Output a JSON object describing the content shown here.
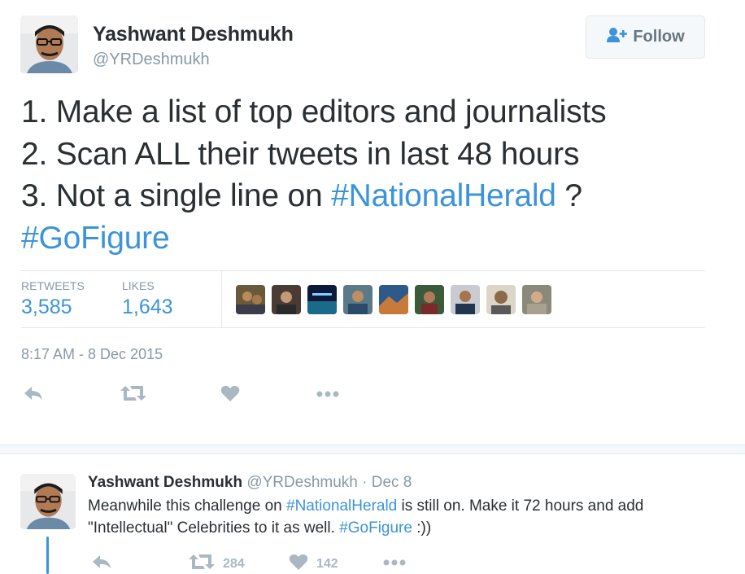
{
  "tweet": {
    "author_name": "Yashwant Deshmukh",
    "author_handle": "@YRDeshmukh",
    "follow_label": "Follow",
    "lines": [
      {
        "text": "1. Make a list of top editors and journalists"
      },
      {
        "text": "2. Scan ALL their tweets in last 48 hours"
      },
      {
        "pre": "3. Not a single line on ",
        "hashtag": "#NationalHerald",
        "post": " ?"
      },
      {
        "hashtag": "#GoFigure"
      }
    ],
    "stats": {
      "retweets_label": "RETWEETS",
      "retweets_value": "3,585",
      "likes_label": "LIKES",
      "likes_value": "1,643"
    },
    "timestamp": "8:17 AM - 8 Dec 2015"
  },
  "reply": {
    "author_name": "Yashwant Deshmukh",
    "author_handle": "@YRDeshmukh",
    "separator": " · ",
    "date": "Dec 8",
    "text_1": "Meanwhile this challenge on ",
    "hashtag_1": "#NationalHerald",
    "text_2": " is still on. Make it 72 hours and add \"Intellectual\" Celebrities to it as well. ",
    "hashtag_2": "#GoFigure",
    "text_3": " :))",
    "retweet_count": "284",
    "like_count": "142"
  },
  "colors": {
    "link": "#3b94d9",
    "muted": "#8899a6",
    "icon": "#aab8c2",
    "text": "#292f33"
  },
  "icons": [
    "follow-person-icon",
    "reply-icon",
    "retweet-icon",
    "heart-icon",
    "more-icon"
  ]
}
